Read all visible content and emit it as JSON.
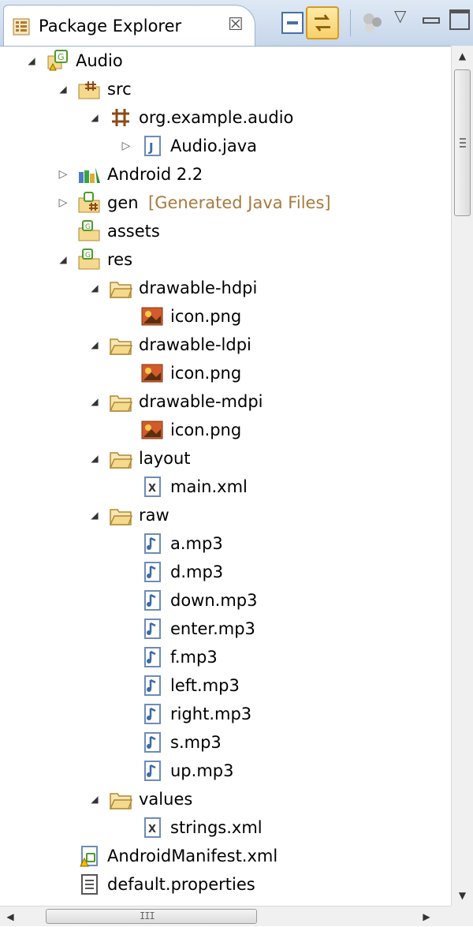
{
  "view": {
    "title": "Package Explorer",
    "close_glyph": "☒",
    "toolbar": {
      "menu_glyph": "▽",
      "icons": [
        "collapse-all-icon",
        "link-with-editor-icon",
        "group-icon",
        "view-menu-icon",
        "minimize-icon",
        "maximize-icon"
      ]
    }
  },
  "tree": {
    "expanded_glyph": "◢",
    "collapsed_glyph": "▷",
    "items": [
      {
        "label": "Audio",
        "icon": "android-project-icon",
        "level": 0,
        "state": "expanded"
      },
      {
        "label": "src",
        "icon": "source-folder-icon",
        "level": 1,
        "state": "expanded"
      },
      {
        "label": "org.example.audio",
        "icon": "package-icon",
        "level": 2,
        "state": "expanded"
      },
      {
        "label": "Audio.java",
        "icon": "java-file-icon",
        "level": 3,
        "state": "collapsed"
      },
      {
        "label": "Android 2.2",
        "icon": "library-icon",
        "level": 1,
        "state": "collapsed"
      },
      {
        "label": "gen",
        "decoration": "[Generated Java Files]",
        "icon": "generated-folder-icon",
        "level": 1,
        "state": "collapsed"
      },
      {
        "label": "assets",
        "icon": "resource-folder-icon",
        "level": 1,
        "state": "leaf"
      },
      {
        "label": "res",
        "icon": "resource-folder-icon",
        "level": 1,
        "state": "expanded"
      },
      {
        "label": "drawable-hdpi",
        "icon": "folder-icon",
        "level": 2,
        "state": "expanded"
      },
      {
        "label": "icon.png",
        "icon": "image-file-icon",
        "level": 3,
        "state": "leaf"
      },
      {
        "label": "drawable-ldpi",
        "icon": "folder-icon",
        "level": 2,
        "state": "expanded"
      },
      {
        "label": "icon.png",
        "icon": "image-file-icon",
        "level": 3,
        "state": "leaf"
      },
      {
        "label": "drawable-mdpi",
        "icon": "folder-icon",
        "level": 2,
        "state": "expanded"
      },
      {
        "label": "icon.png",
        "icon": "image-file-icon",
        "level": 3,
        "state": "leaf"
      },
      {
        "label": "layout",
        "icon": "folder-icon",
        "level": 2,
        "state": "expanded"
      },
      {
        "label": "main.xml",
        "icon": "xml-file-icon",
        "level": 3,
        "state": "leaf"
      },
      {
        "label": "raw",
        "icon": "folder-icon",
        "level": 2,
        "state": "expanded"
      },
      {
        "label": "a.mp3",
        "icon": "audio-file-icon",
        "level": 3,
        "state": "leaf"
      },
      {
        "label": "d.mp3",
        "icon": "audio-file-icon",
        "level": 3,
        "state": "leaf"
      },
      {
        "label": "down.mp3",
        "icon": "audio-file-icon",
        "level": 3,
        "state": "leaf"
      },
      {
        "label": "enter.mp3",
        "icon": "audio-file-icon",
        "level": 3,
        "state": "leaf"
      },
      {
        "label": "f.mp3",
        "icon": "audio-file-icon",
        "level": 3,
        "state": "leaf"
      },
      {
        "label": "left.mp3",
        "icon": "audio-file-icon",
        "level": 3,
        "state": "leaf"
      },
      {
        "label": "right.mp3",
        "icon": "audio-file-icon",
        "level": 3,
        "state": "leaf"
      },
      {
        "label": "s.mp3",
        "icon": "audio-file-icon",
        "level": 3,
        "state": "leaf"
      },
      {
        "label": "up.mp3",
        "icon": "audio-file-icon",
        "level": 3,
        "state": "leaf"
      },
      {
        "label": "values",
        "icon": "folder-icon",
        "level": 2,
        "state": "expanded"
      },
      {
        "label": "strings.xml",
        "icon": "xml-file-icon",
        "level": 3,
        "state": "leaf"
      },
      {
        "label": "AndroidManifest.xml",
        "icon": "manifest-file-icon",
        "level": 1,
        "state": "leaf"
      },
      {
        "label": "default.properties",
        "icon": "text-file-icon",
        "level": 1,
        "state": "leaf"
      }
    ]
  },
  "scrollbars": {
    "vertical_up_glyph": "▲",
    "vertical_down_glyph": "▼",
    "horizontal_left_glyph": "◀",
    "horizontal_right_glyph": "▶",
    "horizontal_grip_glyph": "III"
  },
  "colors": {
    "decoration_text": "#a77a3f",
    "header_gradient_top": "#dfe9f5",
    "header_gradient_bottom": "#c6d6ea",
    "folder_fill": "#f4d98e",
    "package_brown": "#8b4a16"
  }
}
